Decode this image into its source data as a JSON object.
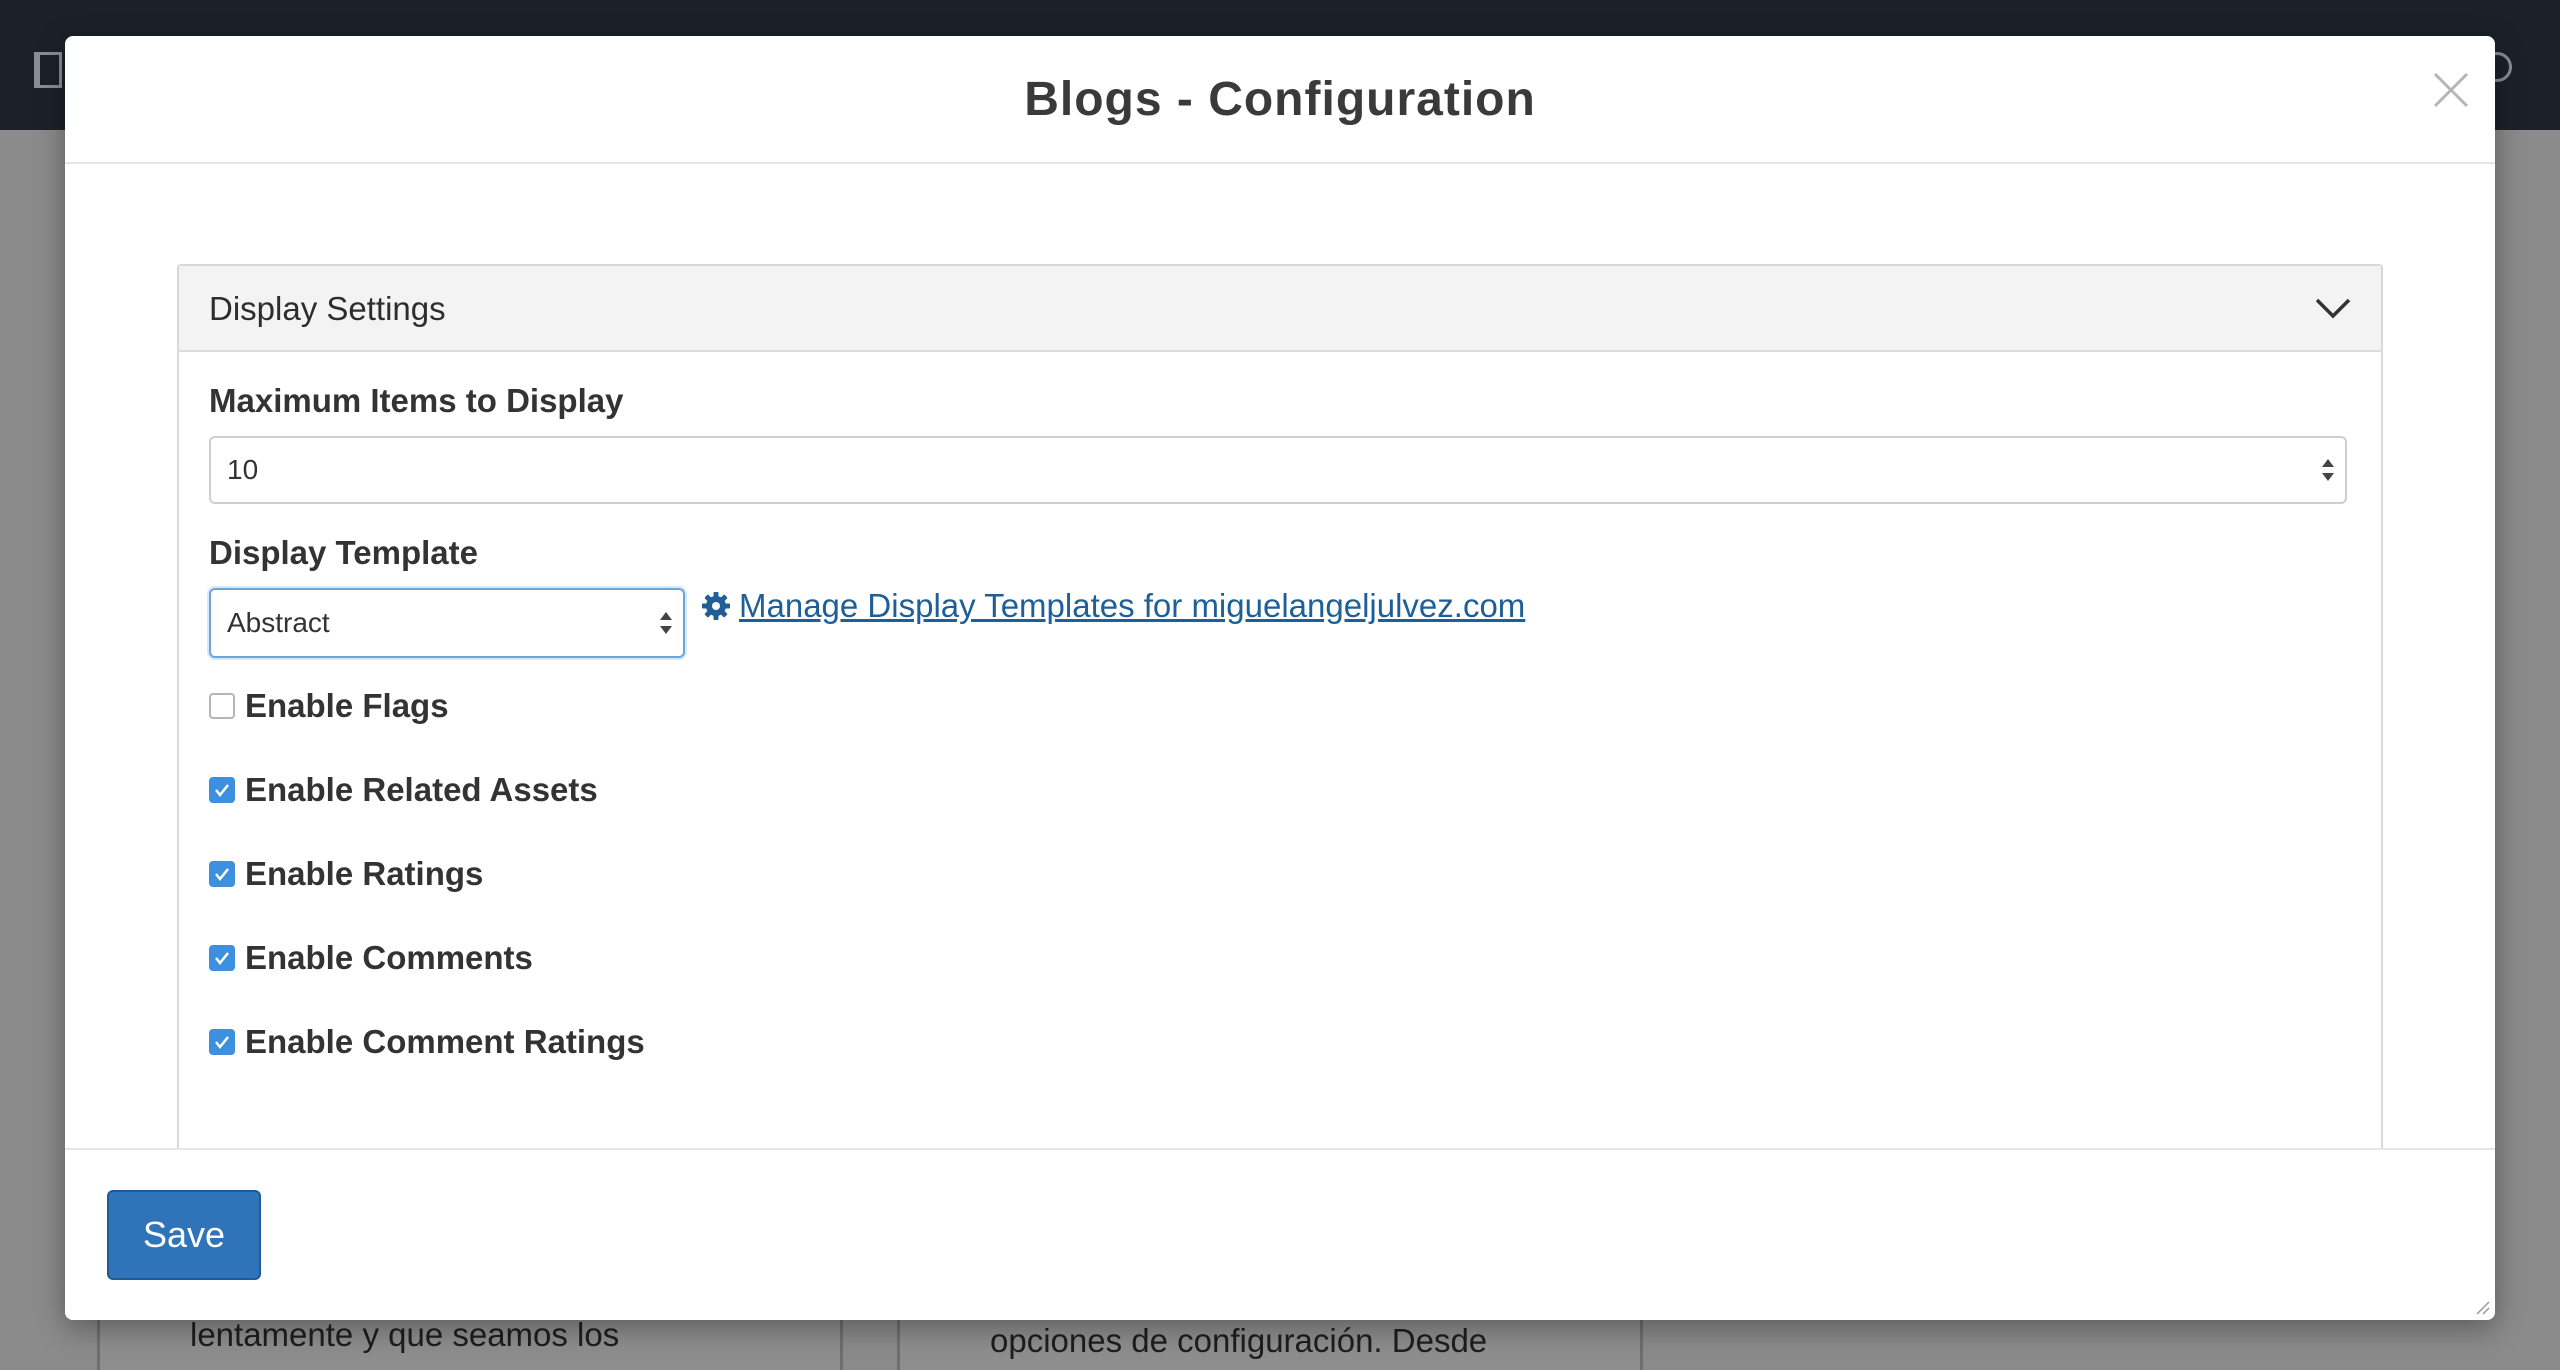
{
  "modal": {
    "title": "Blogs - Configuration",
    "close_icon": "close-icon"
  },
  "panel": {
    "title": "Display Settings",
    "toggle_icon": "chevron-down-icon"
  },
  "max_items": {
    "label": "Maximum Items to Display",
    "value": "10"
  },
  "display_template": {
    "label": "Display Template",
    "value": "Abstract",
    "manage_link": "Manage Display Templates for miguelangeljulvez.com",
    "manage_icon": "gear-icon"
  },
  "options": [
    {
      "label": "Enable Flags",
      "checked": false
    },
    {
      "label": "Enable Related Assets",
      "checked": true
    },
    {
      "label": "Enable Ratings",
      "checked": true
    },
    {
      "label": "Enable Comments",
      "checked": true
    },
    {
      "label": "Enable Comment Ratings",
      "checked": true
    }
  ],
  "footer": {
    "save_label": "Save"
  },
  "background": {
    "text_left": "lentamente y que seamos los",
    "text_right": "opciones de configuración. Desde"
  },
  "colors": {
    "accent": "#2f74b8",
    "link": "#1e5f97",
    "checkbox_checked": "#3d8fe0",
    "topbar": "#1c2129"
  }
}
